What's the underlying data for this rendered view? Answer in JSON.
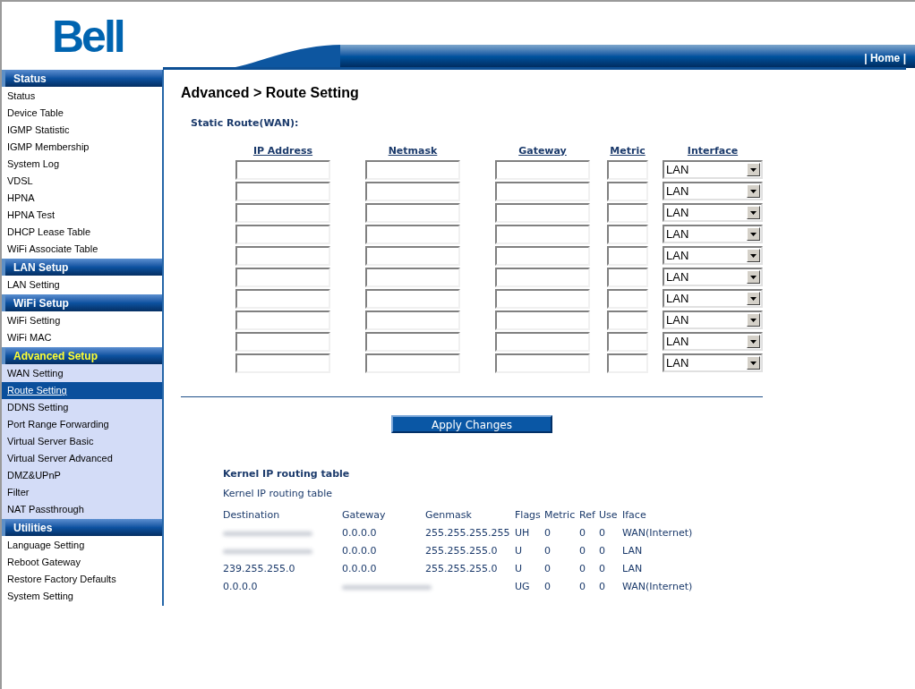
{
  "header": {
    "logo": "Bell",
    "nav_link": "| Home |"
  },
  "sidebar": {
    "sections": [
      {
        "title": "Status",
        "selected": false,
        "items": [
          {
            "label": "Status",
            "selected": false
          },
          {
            "label": "Device Table",
            "selected": false
          },
          {
            "label": "IGMP Statistic",
            "selected": false
          },
          {
            "label": "IGMP Membership",
            "selected": false
          },
          {
            "label": "System Log",
            "selected": false
          },
          {
            "label": "VDSL",
            "selected": false
          },
          {
            "label": "HPNA",
            "selected": false
          },
          {
            "label": "HPNA Test",
            "selected": false
          },
          {
            "label": "DHCP Lease Table",
            "selected": false
          },
          {
            "label": "WiFi Associate Table",
            "selected": false
          }
        ]
      },
      {
        "title": "LAN Setup",
        "selected": false,
        "items": [
          {
            "label": "LAN Setting",
            "selected": false
          }
        ]
      },
      {
        "title": "WiFi Setup",
        "selected": false,
        "items": [
          {
            "label": "WiFi Setting",
            "selected": false
          },
          {
            "label": "WiFi MAC",
            "selected": false
          }
        ]
      },
      {
        "title": "Advanced Setup",
        "selected": true,
        "items": [
          {
            "label": "WAN Setting",
            "selected": false
          },
          {
            "label": "Route Setting",
            "selected": true
          },
          {
            "label": "DDNS Setting",
            "selected": false
          },
          {
            "label": "Port Range Forwarding",
            "selected": false
          },
          {
            "label": "Virtual Server Basic",
            "selected": false
          },
          {
            "label": "Virtual Server Advanced",
            "selected": false
          },
          {
            "label": "DMZ&UPnP",
            "selected": false
          },
          {
            "label": "Filter",
            "selected": false
          },
          {
            "label": "NAT Passthrough",
            "selected": false
          }
        ]
      },
      {
        "title": "Utilities",
        "selected": false,
        "items": [
          {
            "label": "Language Setting",
            "selected": false
          },
          {
            "label": "Reboot Gateway",
            "selected": false
          },
          {
            "label": "Restore Factory Defaults",
            "selected": false
          },
          {
            "label": "System Setting",
            "selected": false
          }
        ]
      }
    ]
  },
  "page_title": "Advanced > Route Setting",
  "static_route": {
    "title": "Static Route(WAN):",
    "columns": [
      "IP Address",
      "Netmask",
      "Gateway",
      "Metric",
      "Interface"
    ],
    "rows": [
      {
        "interface": "LAN"
      },
      {
        "interface": "LAN"
      },
      {
        "interface": "LAN"
      },
      {
        "interface": "LAN"
      },
      {
        "interface": "LAN"
      },
      {
        "interface": "LAN"
      },
      {
        "interface": "LAN"
      },
      {
        "interface": "LAN"
      },
      {
        "interface": "LAN"
      },
      {
        "interface": "LAN"
      }
    ]
  },
  "apply_button": "Apply Changes",
  "kernel": {
    "title": "Kernel IP routing table",
    "subtitle": "Kernel IP routing table",
    "columns": [
      "Destination",
      "Gateway",
      "Genmask",
      "Flags",
      "Metric",
      "Ref",
      "Use",
      "Iface"
    ],
    "rows": [
      [
        {
          "redacted": true
        },
        {
          "text": "0.0.0.0"
        },
        {
          "text": "255.255.255.255"
        },
        {
          "text": "UH"
        },
        {
          "text": "0"
        },
        {
          "text": "0"
        },
        {
          "text": "0"
        },
        {
          "text": "WAN(Internet)"
        }
      ],
      [
        {
          "redacted": true
        },
        {
          "text": "0.0.0.0"
        },
        {
          "text": "255.255.255.0"
        },
        {
          "text": "U"
        },
        {
          "text": "0"
        },
        {
          "text": "0"
        },
        {
          "text": "0"
        },
        {
          "text": "LAN"
        }
      ],
      [
        {
          "text": "239.255.255.0"
        },
        {
          "text": "0.0.0.0"
        },
        {
          "text": "255.255.255.0"
        },
        {
          "text": "U"
        },
        {
          "text": "0"
        },
        {
          "text": "0"
        },
        {
          "text": "0"
        },
        {
          "text": "LAN"
        }
      ],
      [
        {
          "text": "0.0.0.0"
        },
        {
          "redacted": true
        },
        {},
        {
          "text": "UG"
        },
        {
          "text": "0"
        },
        {
          "text": "0"
        },
        {
          "text": "0"
        },
        {
          "text": "WAN(Internet)"
        }
      ]
    ]
  }
}
